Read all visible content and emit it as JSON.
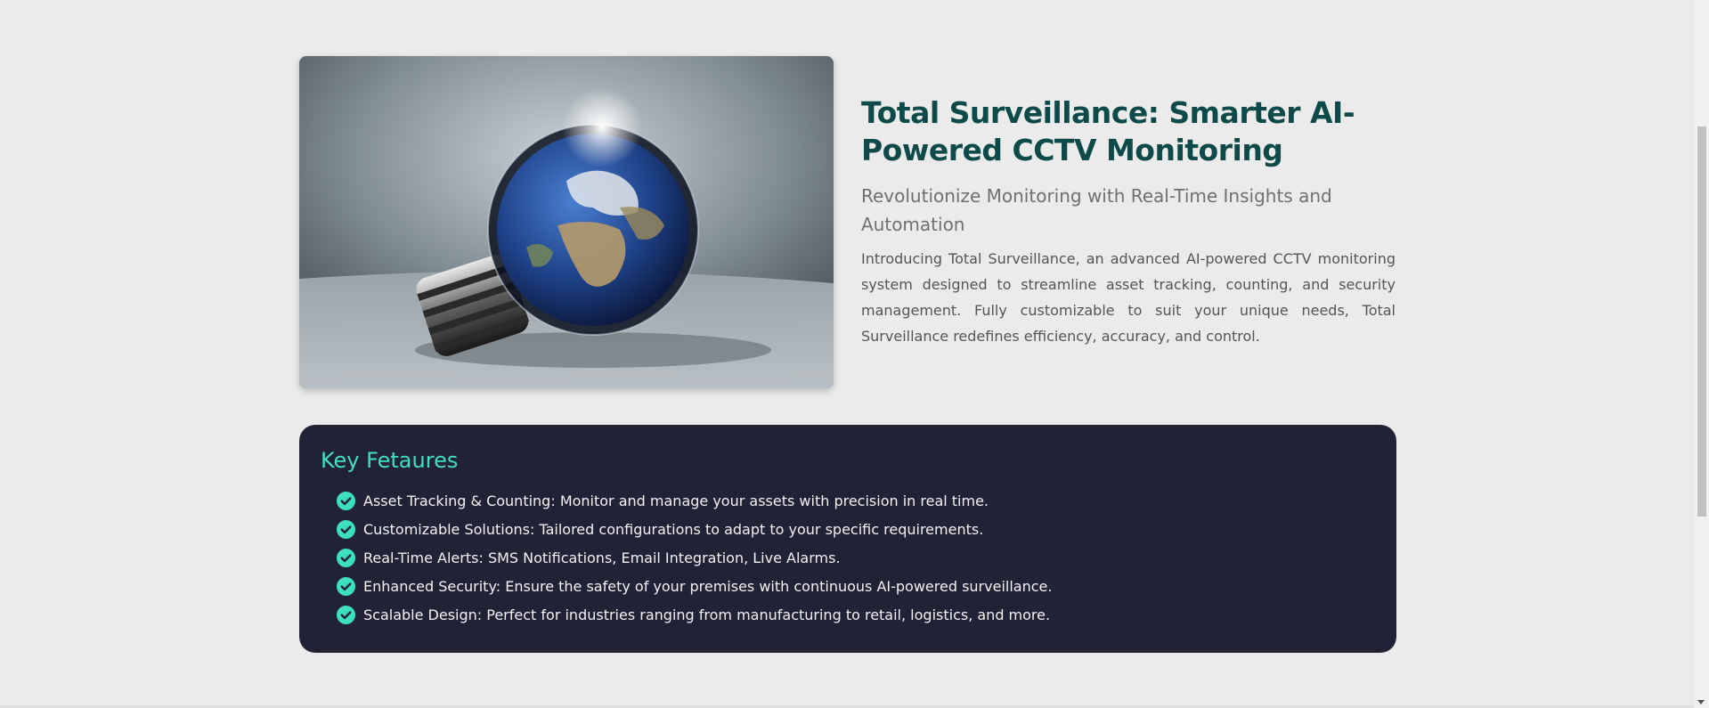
{
  "hero": {
    "image_icon": "earth-lightbulb-image",
    "title": "Total Surveillance: Smarter AI-Powered CCTV Monitoring",
    "subtitle": "Revolutionize Monitoring with Real-Time Insights and Automation",
    "description": "Introducing Total Surveillance, an advanced AI-powered CCTV monitoring system designed to streamline asset tracking, counting, and security management. Fully customizable to suit your unique needs, Total Surveillance redefines efficiency, accuracy, and control."
  },
  "features": {
    "title": "Key Fetaures",
    "items": [
      "Asset Tracking & Counting: Monitor and manage your assets with precision in real time.",
      "Customizable Solutions: Tailored configurations to adapt to your specific requirements.",
      "Real-Time Alerts: SMS Notifications, Email Integration, Live Alarms.",
      "Enhanced Security: Ensure the safety of your premises with continuous AI-powered surveillance.",
      "Scalable Design: Perfect for industries ranging from manufacturing to retail, logistics, and more."
    ]
  },
  "colors": {
    "title": "#0f4a4a",
    "accent": "#3fe0bd",
    "panel": "#222236",
    "background": "#ebebeb"
  }
}
